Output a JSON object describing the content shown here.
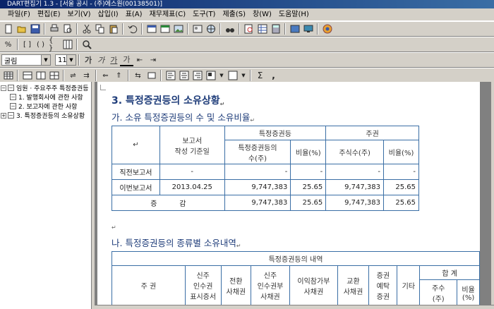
{
  "window": {
    "title": "DART편집기 1.3 - [서울 공시 - (주)에스원(00138501)]"
  },
  "menu": [
    "파일(F)",
    "편집(E)",
    "보기(V)",
    "삽입(I)",
    "표(A)",
    "재무제표(C)",
    "도구(T)",
    "제출(S)",
    "창(W)",
    "도움말(H)"
  ],
  "toolbar3": {
    "font": "굴림",
    "size": "11",
    "bold": "가",
    "italic": "가",
    "underline": "가",
    "color": "가"
  },
  "tree": {
    "items": [
      {
        "label": "임원 · 주요주주 특정증권등",
        "level": 0
      },
      {
        "label": "1. 발행회사에 관한 사항",
        "level": 1
      },
      {
        "label": "2. 보고자에 관한 사항",
        "level": 1
      },
      {
        "label": "3. 특정증권등의 소유상황",
        "level": 1
      }
    ]
  },
  "doc": {
    "heading": "3. 특정증권등의 소유상황",
    "sub1": "가. 소유 특정증권등의 수 및 소유비율",
    "sub2": "나. 특정증권등의 종류별 소유내역",
    "table1": {
      "h_report": "보고서\n작성 기준일",
      "h_special": "특정증권등",
      "h_stock": "주권",
      "h_special_count": "특정증권등의\n수(주)",
      "h_ratio1": "비율(%)",
      "h_stock_count": "주식수(주)",
      "h_ratio2": "비율(%)",
      "rows": [
        {
          "label": "직전보고서",
          "date": "-",
          "v1": "-",
          "r1": "-",
          "v2": "-",
          "r2": "-"
        },
        {
          "label": "이번보고서",
          "date": "2013.04.25",
          "v1": "9,747,383",
          "r1": "25.65",
          "v2": "9,747,383",
          "r2": "25.65"
        },
        {
          "label": "증          감",
          "date": "",
          "v1": "9,747,383",
          "r1": "25.65",
          "v2": "9,747,383",
          "r2": "25.65"
        }
      ]
    },
    "table2": {
      "title": "특정증권등의 내역",
      "h_stock": "주 권",
      "h_c1": "신주\n인수권\n표시증서",
      "h_c2": "전환\n사채권",
      "h_c3": "신주\n인수권부\n사채권",
      "h_c4": "이익참가부\n사채권",
      "h_c5": "교환\n사채권",
      "h_c6": "증권\n예탁\n증권",
      "h_c7": "기타",
      "h_total": "합 계",
      "h_total_count": "주수\n(주)",
      "h_total_ratio": "비율\n(%)"
    }
  }
}
